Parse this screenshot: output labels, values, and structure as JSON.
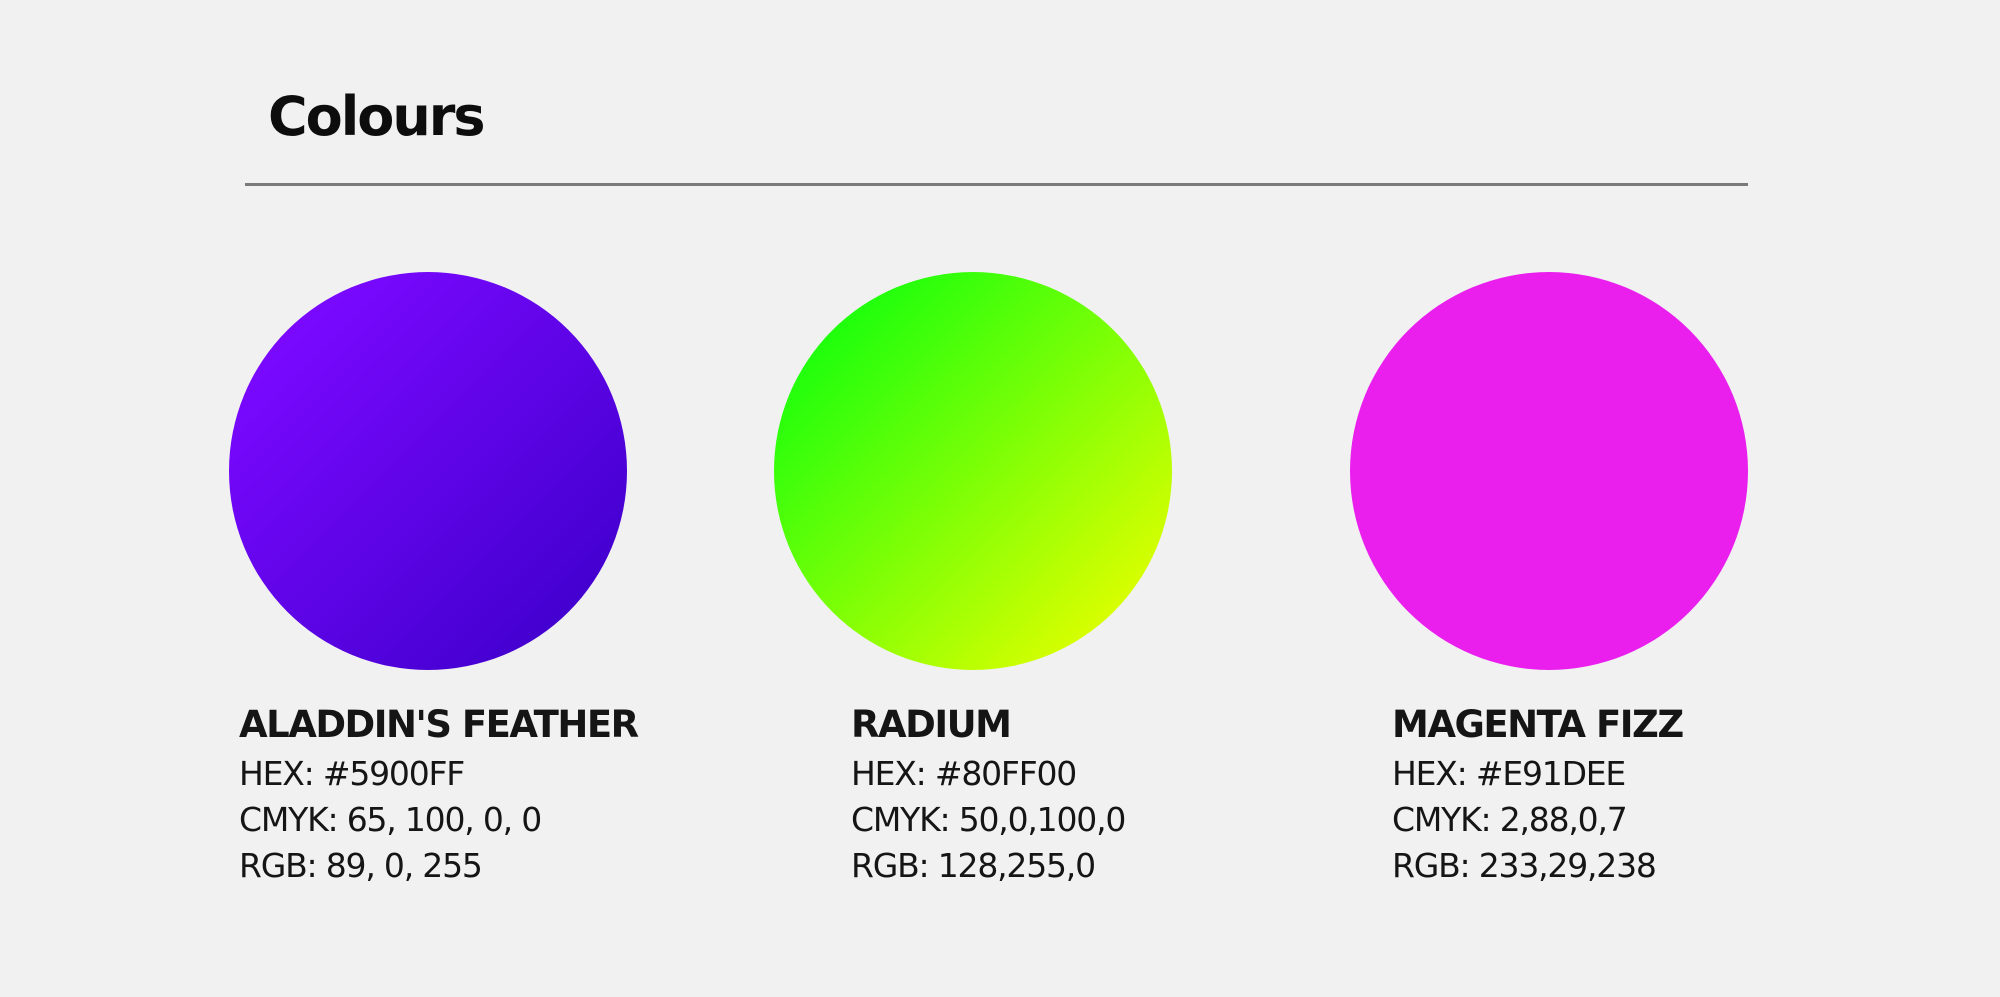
{
  "title": "Colours",
  "swatches": [
    {
      "name": "ALADDIN'S FEATHER",
      "hex": "HEX: #5900FF",
      "cmyk": "CMYK: 65, 100, 0, 0",
      "rgb": "RGB: 89, 0, 255",
      "gradient": [
        "#7a08ff",
        "#4400d0"
      ]
    },
    {
      "name": "RADIUM",
      "hex": "HEX: #80FF00",
      "cmyk": "CMYK: 50,0,100,0",
      "rgb": "RGB: 128,255,0",
      "gradient": [
        "#20ff0c",
        "#d6ff00"
      ]
    },
    {
      "name": "MAGENTA FIZZ",
      "hex": "HEX: #E91DEE",
      "cmyk": "CMYK: 2,88,0,7",
      "rgb": "RGB: 233,29,238",
      "gradient": [
        "#ea1fee",
        "#ea1fee"
      ]
    }
  ]
}
